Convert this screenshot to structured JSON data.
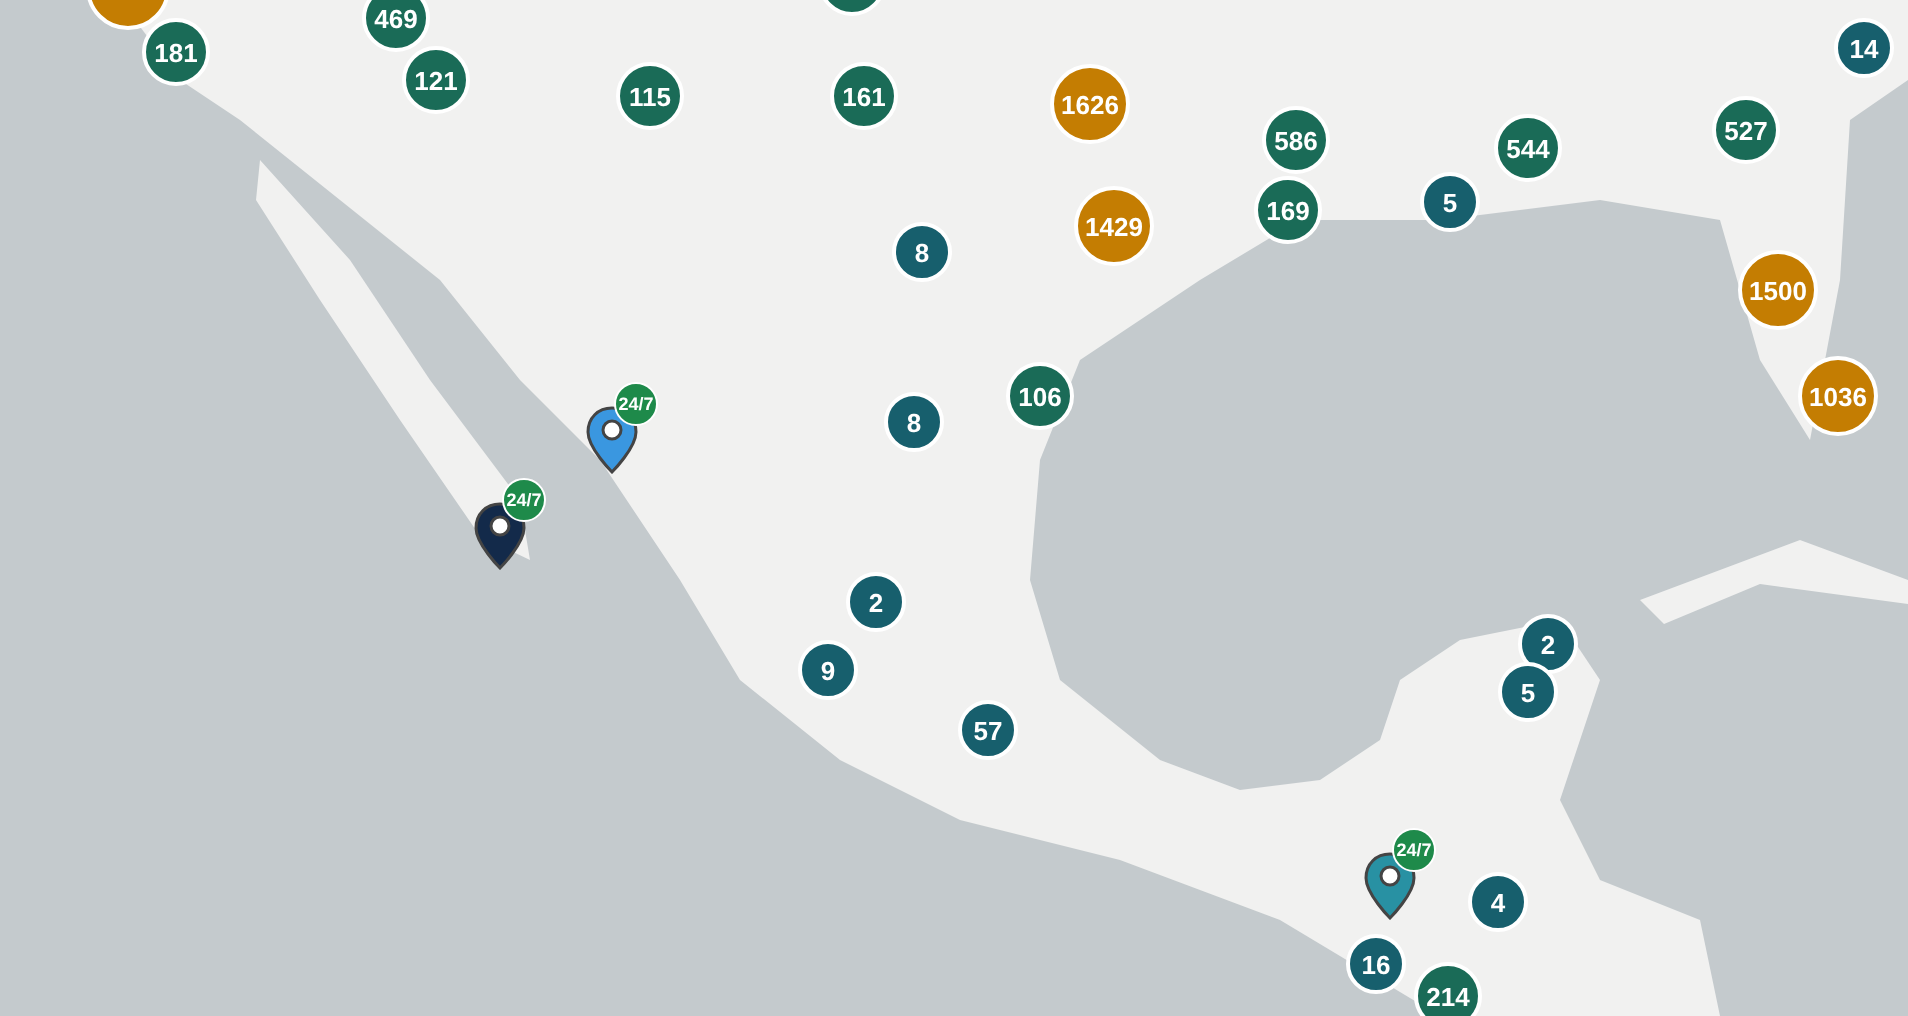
{
  "clusters": [
    {
      "count": "181",
      "kind": "medium"
    },
    {
      "count": "469",
      "kind": "medium"
    },
    {
      "count": "121",
      "kind": "medium"
    },
    {
      "count": "115",
      "kind": "medium"
    },
    {
      "count": "161",
      "kind": "medium"
    },
    {
      "count": "1626",
      "kind": "large"
    },
    {
      "count": "1429",
      "kind": "large"
    },
    {
      "count": "586",
      "kind": "medium"
    },
    {
      "count": "169",
      "kind": "medium"
    },
    {
      "count": "5",
      "kind": "small"
    },
    {
      "count": "544",
      "kind": "medium"
    },
    {
      "count": "527",
      "kind": "medium"
    },
    {
      "count": "14",
      "kind": "small"
    },
    {
      "count": "1500",
      "kind": "large"
    },
    {
      "count": "1036",
      "kind": "large"
    },
    {
      "count": "8",
      "kind": "small"
    },
    {
      "count": "8",
      "kind": "small"
    },
    {
      "count": "106",
      "kind": "medium"
    },
    {
      "count": "2",
      "kind": "small"
    },
    {
      "count": "9",
      "kind": "small"
    },
    {
      "count": "57",
      "kind": "small"
    },
    {
      "count": "2",
      "kind": "small"
    },
    {
      "count": "5",
      "kind": "small"
    },
    {
      "count": "4",
      "kind": "small"
    },
    {
      "count": "16",
      "kind": "small"
    },
    {
      "count": "214",
      "kind": "medium"
    }
  ],
  "pins": [
    {
      "color": "#3a97e0",
      "badge": "24/7"
    },
    {
      "color": "#132a4a",
      "badge": "24/7"
    },
    {
      "color": "#2891a3",
      "badge": "24/7"
    }
  ]
}
